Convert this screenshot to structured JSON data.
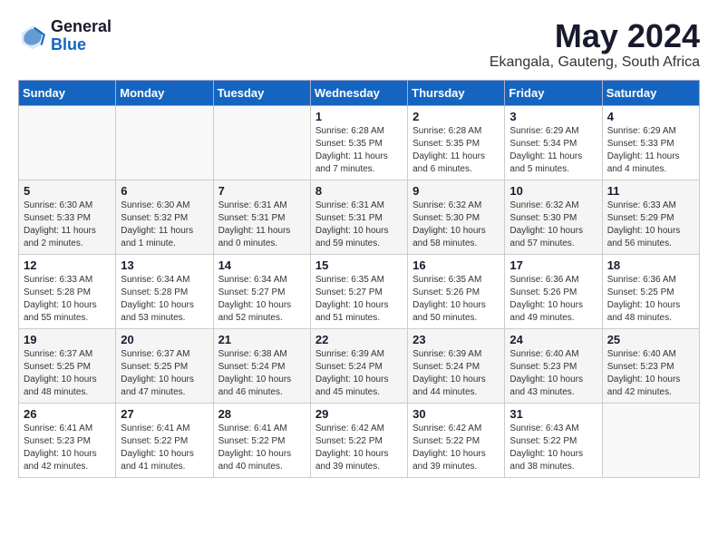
{
  "logo": {
    "general": "General",
    "blue": "Blue"
  },
  "title": {
    "month": "May 2024",
    "location": "Ekangala, Gauteng, South Africa"
  },
  "calendar": {
    "days_of_week": [
      "Sunday",
      "Monday",
      "Tuesday",
      "Wednesday",
      "Thursday",
      "Friday",
      "Saturday"
    ],
    "weeks": [
      [
        {
          "day": "",
          "details": ""
        },
        {
          "day": "",
          "details": ""
        },
        {
          "day": "",
          "details": ""
        },
        {
          "day": "1",
          "details": "Sunrise: 6:28 AM\nSunset: 5:35 PM\nDaylight: 11 hours\nand 7 minutes."
        },
        {
          "day": "2",
          "details": "Sunrise: 6:28 AM\nSunset: 5:35 PM\nDaylight: 11 hours\nand 6 minutes."
        },
        {
          "day": "3",
          "details": "Sunrise: 6:29 AM\nSunset: 5:34 PM\nDaylight: 11 hours\nand 5 minutes."
        },
        {
          "day": "4",
          "details": "Sunrise: 6:29 AM\nSunset: 5:33 PM\nDaylight: 11 hours\nand 4 minutes."
        }
      ],
      [
        {
          "day": "5",
          "details": "Sunrise: 6:30 AM\nSunset: 5:33 PM\nDaylight: 11 hours\nand 2 minutes."
        },
        {
          "day": "6",
          "details": "Sunrise: 6:30 AM\nSunset: 5:32 PM\nDaylight: 11 hours\nand 1 minute."
        },
        {
          "day": "7",
          "details": "Sunrise: 6:31 AM\nSunset: 5:31 PM\nDaylight: 11 hours\nand 0 minutes."
        },
        {
          "day": "8",
          "details": "Sunrise: 6:31 AM\nSunset: 5:31 PM\nDaylight: 10 hours\nand 59 minutes."
        },
        {
          "day": "9",
          "details": "Sunrise: 6:32 AM\nSunset: 5:30 PM\nDaylight: 10 hours\nand 58 minutes."
        },
        {
          "day": "10",
          "details": "Sunrise: 6:32 AM\nSunset: 5:30 PM\nDaylight: 10 hours\nand 57 minutes."
        },
        {
          "day": "11",
          "details": "Sunrise: 6:33 AM\nSunset: 5:29 PM\nDaylight: 10 hours\nand 56 minutes."
        }
      ],
      [
        {
          "day": "12",
          "details": "Sunrise: 6:33 AM\nSunset: 5:28 PM\nDaylight: 10 hours\nand 55 minutes."
        },
        {
          "day": "13",
          "details": "Sunrise: 6:34 AM\nSunset: 5:28 PM\nDaylight: 10 hours\nand 53 minutes."
        },
        {
          "day": "14",
          "details": "Sunrise: 6:34 AM\nSunset: 5:27 PM\nDaylight: 10 hours\nand 52 minutes."
        },
        {
          "day": "15",
          "details": "Sunrise: 6:35 AM\nSunset: 5:27 PM\nDaylight: 10 hours\nand 51 minutes."
        },
        {
          "day": "16",
          "details": "Sunrise: 6:35 AM\nSunset: 5:26 PM\nDaylight: 10 hours\nand 50 minutes."
        },
        {
          "day": "17",
          "details": "Sunrise: 6:36 AM\nSunset: 5:26 PM\nDaylight: 10 hours\nand 49 minutes."
        },
        {
          "day": "18",
          "details": "Sunrise: 6:36 AM\nSunset: 5:25 PM\nDaylight: 10 hours\nand 48 minutes."
        }
      ],
      [
        {
          "day": "19",
          "details": "Sunrise: 6:37 AM\nSunset: 5:25 PM\nDaylight: 10 hours\nand 48 minutes."
        },
        {
          "day": "20",
          "details": "Sunrise: 6:37 AM\nSunset: 5:25 PM\nDaylight: 10 hours\nand 47 minutes."
        },
        {
          "day": "21",
          "details": "Sunrise: 6:38 AM\nSunset: 5:24 PM\nDaylight: 10 hours\nand 46 minutes."
        },
        {
          "day": "22",
          "details": "Sunrise: 6:39 AM\nSunset: 5:24 PM\nDaylight: 10 hours\nand 45 minutes."
        },
        {
          "day": "23",
          "details": "Sunrise: 6:39 AM\nSunset: 5:24 PM\nDaylight: 10 hours\nand 44 minutes."
        },
        {
          "day": "24",
          "details": "Sunrise: 6:40 AM\nSunset: 5:23 PM\nDaylight: 10 hours\nand 43 minutes."
        },
        {
          "day": "25",
          "details": "Sunrise: 6:40 AM\nSunset: 5:23 PM\nDaylight: 10 hours\nand 42 minutes."
        }
      ],
      [
        {
          "day": "26",
          "details": "Sunrise: 6:41 AM\nSunset: 5:23 PM\nDaylight: 10 hours\nand 42 minutes."
        },
        {
          "day": "27",
          "details": "Sunrise: 6:41 AM\nSunset: 5:22 PM\nDaylight: 10 hours\nand 41 minutes."
        },
        {
          "day": "28",
          "details": "Sunrise: 6:41 AM\nSunset: 5:22 PM\nDaylight: 10 hours\nand 40 minutes."
        },
        {
          "day": "29",
          "details": "Sunrise: 6:42 AM\nSunset: 5:22 PM\nDaylight: 10 hours\nand 39 minutes."
        },
        {
          "day": "30",
          "details": "Sunrise: 6:42 AM\nSunset: 5:22 PM\nDaylight: 10 hours\nand 39 minutes."
        },
        {
          "day": "31",
          "details": "Sunrise: 6:43 AM\nSunset: 5:22 PM\nDaylight: 10 hours\nand 38 minutes."
        },
        {
          "day": "",
          "details": ""
        }
      ]
    ]
  }
}
